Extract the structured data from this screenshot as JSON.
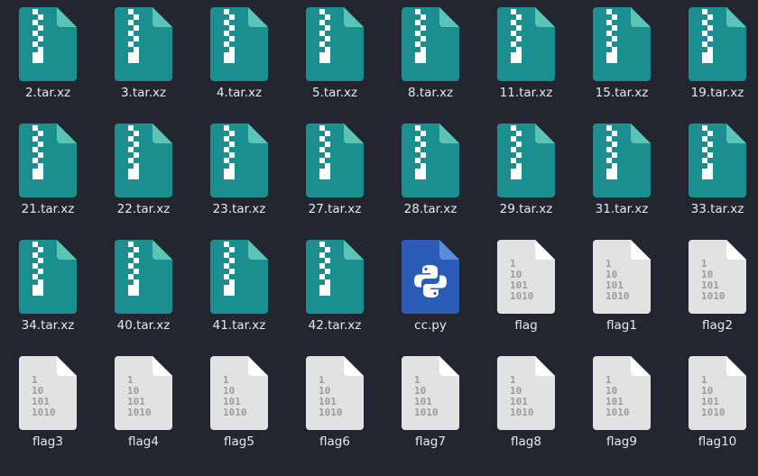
{
  "files": [
    {
      "name": "2.tar.xz",
      "icon": "archive-icon"
    },
    {
      "name": "3.tar.xz",
      "icon": "archive-icon"
    },
    {
      "name": "4.tar.xz",
      "icon": "archive-icon"
    },
    {
      "name": "5.tar.xz",
      "icon": "archive-icon"
    },
    {
      "name": "8.tar.xz",
      "icon": "archive-icon"
    },
    {
      "name": "11.tar.xz",
      "icon": "archive-icon"
    },
    {
      "name": "15.tar.xz",
      "icon": "archive-icon"
    },
    {
      "name": "19.tar.xz",
      "icon": "archive-icon"
    },
    {
      "name": "21.tar.xz",
      "icon": "archive-icon"
    },
    {
      "name": "22.tar.xz",
      "icon": "archive-icon"
    },
    {
      "name": "23.tar.xz",
      "icon": "archive-icon"
    },
    {
      "name": "27.tar.xz",
      "icon": "archive-icon"
    },
    {
      "name": "28.tar.xz",
      "icon": "archive-icon"
    },
    {
      "name": "29.tar.xz",
      "icon": "archive-icon"
    },
    {
      "name": "31.tar.xz",
      "icon": "archive-icon"
    },
    {
      "name": "33.tar.xz",
      "icon": "archive-icon"
    },
    {
      "name": "34.tar.xz",
      "icon": "archive-icon"
    },
    {
      "name": "40.tar.xz",
      "icon": "archive-icon"
    },
    {
      "name": "41.tar.xz",
      "icon": "archive-icon"
    },
    {
      "name": "42.tar.xz",
      "icon": "archive-icon"
    },
    {
      "name": "cc.py",
      "icon": "python-file-icon"
    },
    {
      "name": "flag",
      "icon": "binary-file-icon"
    },
    {
      "name": "flag1",
      "icon": "binary-file-icon"
    },
    {
      "name": "flag2",
      "icon": "binary-file-icon"
    },
    {
      "name": "flag3",
      "icon": "binary-file-icon"
    },
    {
      "name": "flag4",
      "icon": "binary-file-icon"
    },
    {
      "name": "flag5",
      "icon": "binary-file-icon"
    },
    {
      "name": "flag6",
      "icon": "binary-file-icon"
    },
    {
      "name": "flag7",
      "icon": "binary-file-icon"
    },
    {
      "name": "flag8",
      "icon": "binary-file-icon"
    },
    {
      "name": "flag9",
      "icon": "binary-file-icon"
    },
    {
      "name": "flag10",
      "icon": "binary-file-icon"
    }
  ],
  "binary_icon_text": [
    "1",
    "10",
    "101",
    "1010"
  ],
  "colors": {
    "background": "#232630",
    "archive": "#1b8f8f",
    "archive_fold": "#5cc4b4",
    "python": "#2a5cb8",
    "python_fold": "#5a8cdc",
    "binary": "#e2e2e2",
    "binary_fold": "#ffffff",
    "binary_text": "#9c9c9c",
    "label": "#e8e8ea"
  }
}
